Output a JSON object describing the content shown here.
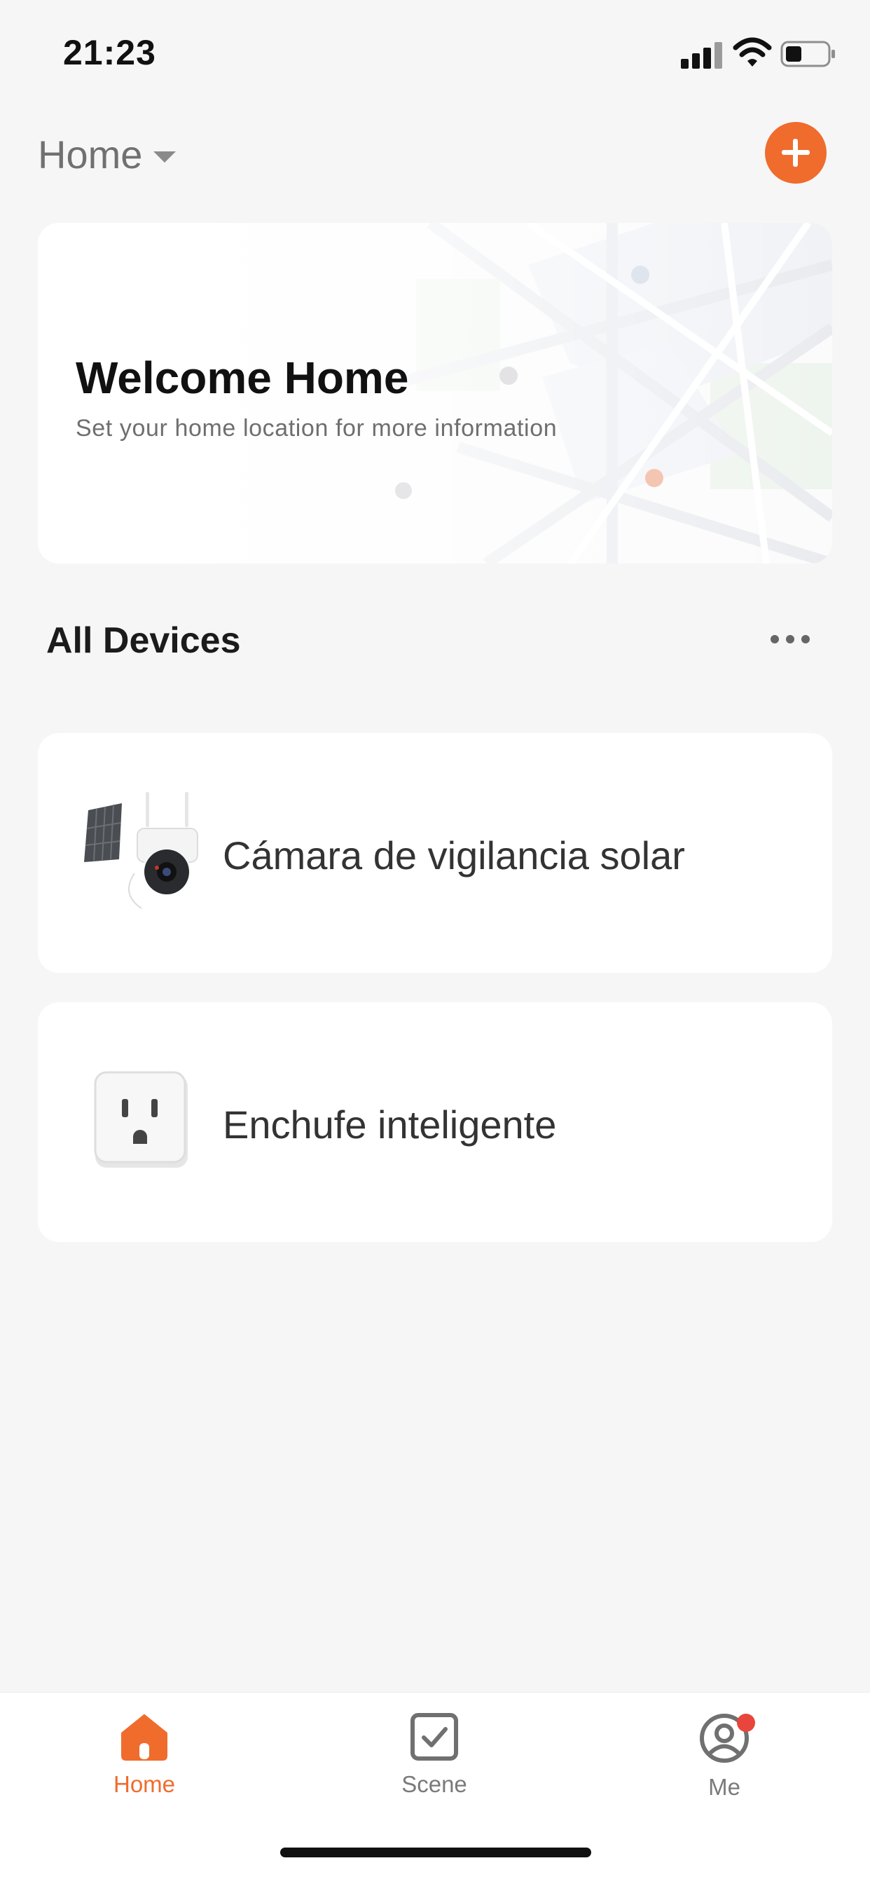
{
  "status_bar": {
    "time": "21:23"
  },
  "header": {
    "home_title": "Home"
  },
  "welcome_card": {
    "title": "Welcome Home",
    "subtitle": "Set your home location for more information"
  },
  "devices_section": {
    "title": "All Devices",
    "devices": [
      {
        "name": "Cámara de vigilancia solar",
        "icon": "solar-camera-icon"
      },
      {
        "name": "Enchufe inteligente",
        "icon": "smart-plug-icon"
      }
    ]
  },
  "tab_bar": {
    "active": "Home",
    "tabs": [
      {
        "label": "Home",
        "icon": "house-icon"
      },
      {
        "label": "Scene",
        "icon": "checkbox-icon"
      },
      {
        "label": "Me",
        "icon": "profile-icon"
      }
    ]
  },
  "colors": {
    "accent": "#ef6c2d",
    "badge": "#e8453c",
    "background": "#f6f6f6"
  }
}
